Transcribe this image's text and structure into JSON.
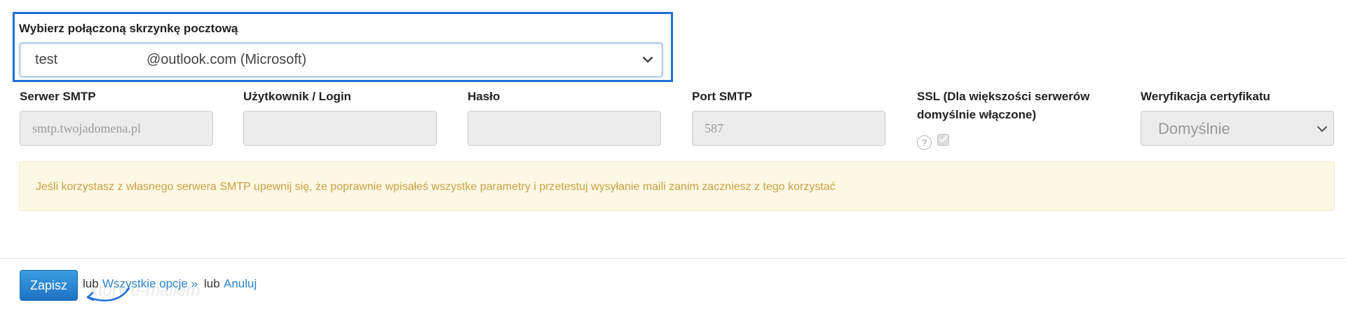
{
  "mailbox": {
    "label": "Wybierz połączoną skrzynkę pocztową",
    "selected_prefix": "test",
    "selected_suffix": "@outlook.com (Microsoft)"
  },
  "fields": {
    "smtp_server": {
      "label": "Serwer SMTP",
      "placeholder": "smtp.twojadomena.pl"
    },
    "username": {
      "label": "Użytkownik / Login",
      "value": ""
    },
    "password": {
      "label": "Hasło",
      "value": ""
    },
    "port": {
      "label": "Port SMTP",
      "placeholder": "587"
    },
    "ssl": {
      "label": "SSL (Dla większości serwerów domyślnie włączone)",
      "help": "?",
      "checked": true
    },
    "cert": {
      "label": "Weryfikacja certyfikatu",
      "selected": "Domyślnie"
    }
  },
  "alert": {
    "text": "Jeśli korzystasz z własnego serwera SMTP upewnij się, że poprawnie wpisałeś wszystke parametry i przetestuj wysyłanie maili zanim zaczniesz z tego korzystać"
  },
  "footer": {
    "save_label": "Zapisz",
    "or1": "lub",
    "all_options": "Wszystkie opcje »",
    "or2": "lub",
    "cancel": "Anuluj",
    "ghost": "ktory e-mailem"
  },
  "colors": {
    "highlight_border": "#1f6fd6",
    "primary_button": "#2a86d3",
    "link": "#2e84c9",
    "alert_bg": "#fcf8e3",
    "alert_text": "#c8a045"
  },
  "icons": {
    "select_arrow": "chevron-down-icon",
    "help": "question-circle-icon",
    "annotation_arrow": "curved-arrow-icon"
  }
}
